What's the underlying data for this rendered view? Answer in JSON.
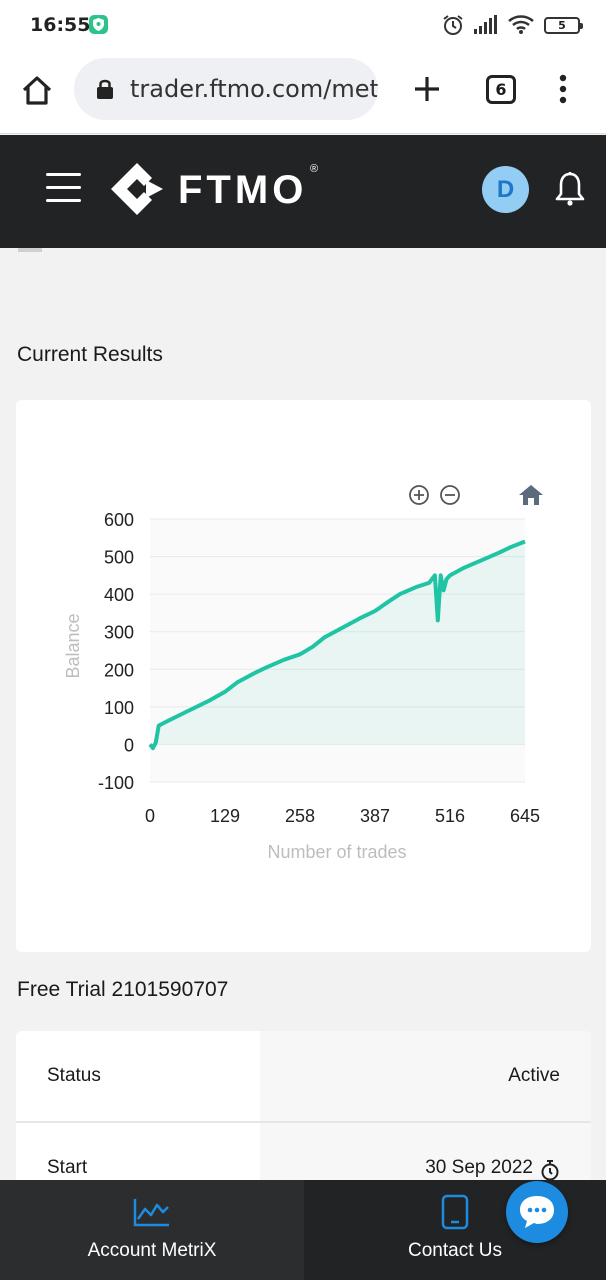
{
  "status_bar": {
    "time": "16:55",
    "vpn_icon": "shield-icon",
    "right_icons": [
      "alarm-icon",
      "signal-icon",
      "wifi-icon"
    ],
    "battery": "5"
  },
  "browser": {
    "url": "trader.ftmo.com/metr",
    "tab_count": "6",
    "icons": [
      "home-icon",
      "lock-icon",
      "plus-icon",
      "more-vert-icon"
    ]
  },
  "header": {
    "brand": "FTMO",
    "registered": "®",
    "avatar_initial": "D",
    "icons": [
      "hamburger-icon",
      "bell-icon"
    ],
    "colors": {
      "background": "#222325",
      "avatar_bg": "#93cdf3",
      "avatar_text": "#1d76c7"
    }
  },
  "current_results": {
    "title": "Current Results",
    "toolbar_icons": [
      "zoom-in-icon",
      "zoom-out-icon",
      "home-icon"
    ]
  },
  "chart_data": {
    "type": "area",
    "xlabel": "Number of trades",
    "ylabel": "Balance",
    "x_ticks": [
      "0",
      "129",
      "258",
      "387",
      "516",
      "645"
    ],
    "y_ticks": [
      "600",
      "500",
      "400",
      "300",
      "200",
      "100",
      "0",
      "-100"
    ],
    "xlim": [
      0,
      645
    ],
    "ylim": [
      -100,
      600
    ],
    "grid": true,
    "color": "#1fc4a4",
    "series": [
      {
        "x": [
          0,
          5,
          10,
          15,
          30,
          60,
          100,
          129,
          150,
          180,
          200,
          230,
          258,
          280,
          300,
          330,
          360,
          387,
          410,
          430,
          460,
          480,
          490,
          495,
          500,
          505,
          510,
          516,
          540,
          570,
          600,
          620,
          645
        ],
        "values": [
          0,
          -10,
          5,
          50,
          62,
          85,
          115,
          140,
          165,
          190,
          205,
          225,
          240,
          260,
          285,
          310,
          335,
          355,
          380,
          400,
          420,
          430,
          450,
          330,
          450,
          410,
          440,
          450,
          470,
          490,
          510,
          525,
          540
        ]
      }
    ]
  },
  "account": {
    "title": "Free Trial 2101590707",
    "rows": [
      {
        "label": "Status",
        "value": "Active"
      },
      {
        "label": "Start",
        "value": "30 Sep 2022"
      }
    ],
    "start_icon": "stopwatch-icon"
  },
  "bottom_nav": {
    "items": [
      {
        "label": "Account MetriX",
        "icon": "chart-line-icon"
      },
      {
        "label": "Contact Us",
        "icon": "phone-icon"
      }
    ],
    "accent": "#1d8ce0",
    "chat_icon": "chat-bubble-icon"
  }
}
